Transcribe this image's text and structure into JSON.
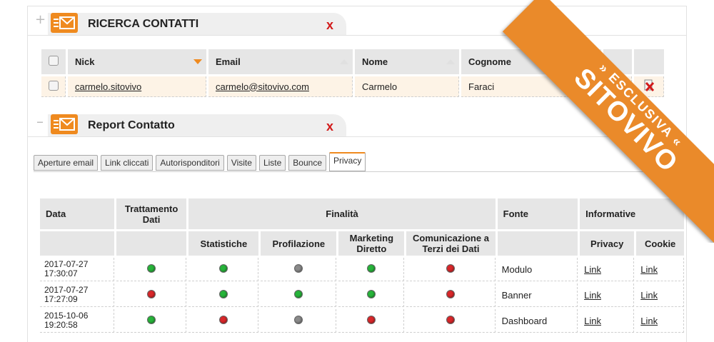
{
  "panel_search": {
    "title": "RICERCA CONTATTI",
    "close": "x",
    "toggle": "+"
  },
  "contacts": {
    "headers": [
      "Nick",
      "Email",
      "Nome",
      "Cognome"
    ],
    "row": {
      "nick": "carmelo.sitovivo",
      "email": "carmelo@sitovivo.com",
      "nome": "Carmelo",
      "cognome": "Faraci"
    }
  },
  "panel_report": {
    "title": "Report Contatto",
    "close": "x",
    "toggle": "–"
  },
  "subtabs": [
    "Aperture email",
    "Link cliccati",
    "Autorisponditori",
    "Visite",
    "Liste",
    "Bounce",
    "Privacy"
  ],
  "report": {
    "h_data": "Data",
    "h_trattamento": "Trattamento Dati",
    "h_finalita": "Finalità",
    "h_fonte": "Fonte",
    "h_informative": "Informative",
    "h_statistiche": "Statistiche",
    "h_profilazione": "Profilazione",
    "h_marketing": "Marketing Diretto",
    "h_comunicazione": "Comunicazione a Terzi dei Dati",
    "h_privacy": "Privacy",
    "h_cookie": "Cookie",
    "rows": [
      {
        "date": "2017-07-27",
        "time": "17:30:07",
        "fonte": "Modulo",
        "privacy": "Link",
        "cookie": "Link",
        "status": [
          "green",
          "green",
          "gray",
          "green",
          "red"
        ]
      },
      {
        "date": "2017-07-27",
        "time": "17:27:09",
        "fonte": "Banner",
        "privacy": "Link",
        "cookie": "Link",
        "status": [
          "red",
          "green",
          "green",
          "green",
          "red"
        ]
      },
      {
        "date": "2015-10-06",
        "time": "19:20:58",
        "fonte": "Dashboard",
        "privacy": "Link",
        "cookie": "Link",
        "status": [
          "green",
          "red",
          "gray",
          "red",
          "red"
        ]
      }
    ]
  },
  "ribbon": {
    "line1": "» ESCLUSIVA «",
    "line2": "SITOVIVO"
  },
  "colors": {
    "green": "#27b43a",
    "red": "#d9272a",
    "gray": "#8a8a8a",
    "accent": "#ef8a1f"
  }
}
